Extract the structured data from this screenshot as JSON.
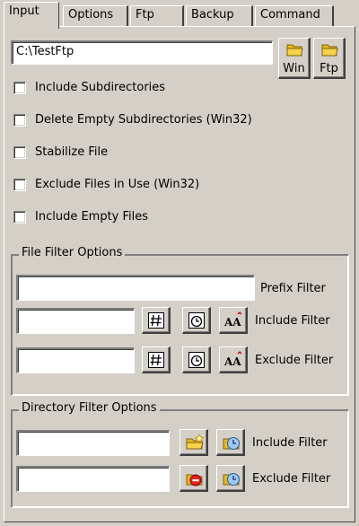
{
  "tabs": [
    {
      "label": "Input",
      "active": true
    },
    {
      "label": "Options",
      "active": false
    },
    {
      "label": "Ftp",
      "active": false
    },
    {
      "label": "Backup",
      "active": false
    },
    {
      "label": "Command",
      "active": false
    }
  ],
  "input": {
    "path_value": "C:\\TestFtp",
    "win_button_label": "Win",
    "ftp_button_label": "Ftp"
  },
  "checkboxes": [
    {
      "label": "Include Subdirectories",
      "checked": false
    },
    {
      "label": "Delete Empty Subdirectories (Win32)",
      "checked": false
    },
    {
      "label": "Stabilize File",
      "checked": false
    },
    {
      "label": "Exclude Files in Use (Win32)",
      "checked": false
    },
    {
      "label": "Include Empty Files",
      "checked": false
    }
  ],
  "file_filter": {
    "title": "File Filter Options",
    "prefix_label": "Prefix Filter",
    "include_label": "Include Filter",
    "exclude_label": "Exclude Filter",
    "prefix_value": "",
    "include_value": "",
    "exclude_value": "",
    "case_icon_text": "AA"
  },
  "dir_filter": {
    "title": "Directory Filter Options",
    "include_label": "Include Filter",
    "exclude_label": "Exclude Filter",
    "include_value": "",
    "exclude_value": ""
  },
  "colors": {
    "face": "#d4d0c8",
    "folder_yellow": "#f5d24a",
    "gear_yellow": "#f0c020",
    "minus_red": "#e02020"
  },
  "icons": [
    "folder-icon",
    "hash-icon",
    "clock-icon",
    "case-icon",
    "folder-add-icon",
    "folder-remove-icon",
    "folder-clock-icon"
  ]
}
